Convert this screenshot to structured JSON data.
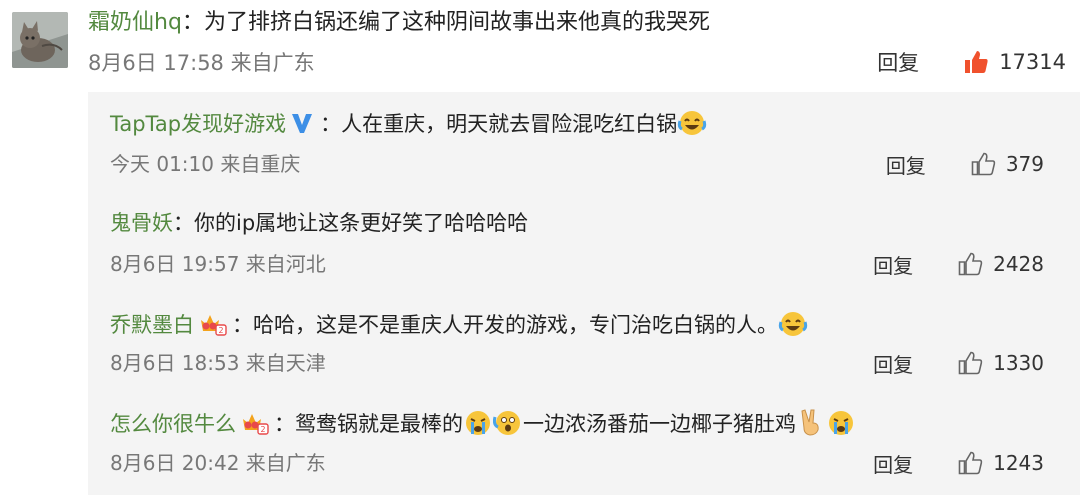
{
  "main_comment": {
    "username": "霜奶仙hq",
    "separator": "：",
    "text": "为了排挤白锅还编了这种阴间故事出来他真的我哭死",
    "meta": "8月6日 17:58 来自广东",
    "reply_label": "回复",
    "like_count": "17314",
    "like_color": "#f0512d",
    "avatar_icon": "cat-avatar-icon"
  },
  "replies": [
    {
      "username": "TapTap发现好游戏",
      "badge": "verified-v-icon",
      "separator": "：",
      "text": "人在重庆，明天就去冒险混吃红白锅",
      "emojis": [
        "laugh-cry-emoji"
      ],
      "meta": "今天 01:10 来自重庆",
      "reply_label": "回复",
      "like_count": "379"
    },
    {
      "username": "鬼骨妖",
      "separator": "：",
      "text": "你的ip属地让这条更好笑了哈哈哈哈",
      "meta": "8月6日 19:57 来自河北",
      "reply_label": "回复",
      "like_count": "2428"
    },
    {
      "username": "乔默墨白",
      "badge": "crown-fan-icon",
      "separator": "：",
      "text": "哈哈，这是不是重庆人开发的游戏，专门治吃白锅的人。",
      "emojis": [
        "laugh-cry-emoji"
      ],
      "meta": "8月6日 18:53 来自天津",
      "reply_label": "回复",
      "like_count": "1330"
    },
    {
      "username": "怎么你很牛么",
      "badge": "crown-fan-icon",
      "separator": "：",
      "text_part1": "鸳鸯锅就是最棒的",
      "text_part2": "一边浓汤番茄一边椰子猪肚鸡",
      "emojis": [
        "crying-emoji",
        "scared-emoji",
        "victory-hand-emoji",
        "crying-emoji"
      ],
      "meta": "8月6日 20:42 来自广东",
      "reply_label": "回复",
      "like_count": "1243"
    }
  ],
  "colors": {
    "username": "#53893f",
    "meta": "#777777",
    "reply_bg": "#f4f4f4",
    "like_active": "#f0512d"
  }
}
